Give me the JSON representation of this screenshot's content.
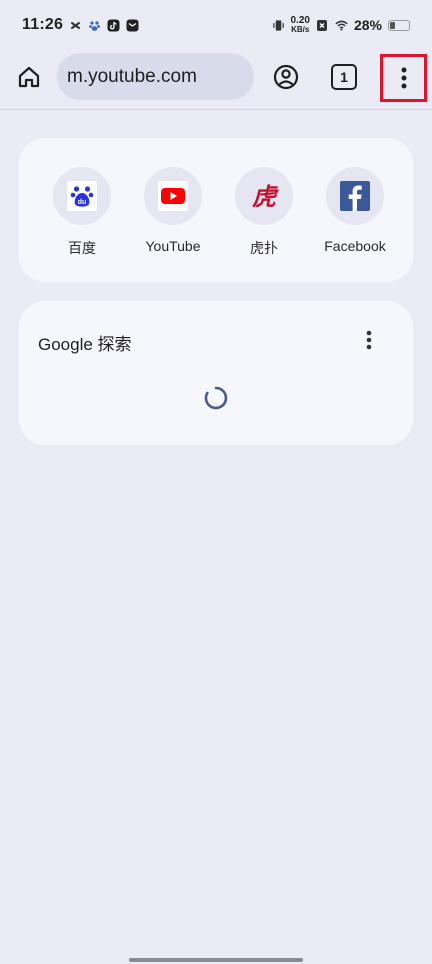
{
  "status_bar": {
    "time": "11:26",
    "net_speed_value": "0.20",
    "net_speed_unit": "KB/s",
    "battery_percent": "28%",
    "battery_level": 0.28
  },
  "toolbar": {
    "url": "m.youtube.com",
    "tab_count": "1"
  },
  "shortcuts": [
    {
      "label": "百度",
      "icon": "baidu-icon"
    },
    {
      "label": "YouTube",
      "icon": "youtube-icon"
    },
    {
      "label": "虎扑",
      "icon": "hupu-icon"
    },
    {
      "label": "Facebook",
      "icon": "facebook-icon"
    }
  ],
  "search_card": {
    "title": "Google 探索"
  },
  "colors": {
    "background": "#ebebf5",
    "card": "#f6f6fd",
    "omnibox": "#d8dbe9",
    "highlight": "#e0152b",
    "youtube_red": "#ff0000",
    "facebook_blue": "#3b5998",
    "baidu_blue": "#2932e1",
    "hupu_red": "#c8102e",
    "spinner": "#4a5a8a"
  }
}
